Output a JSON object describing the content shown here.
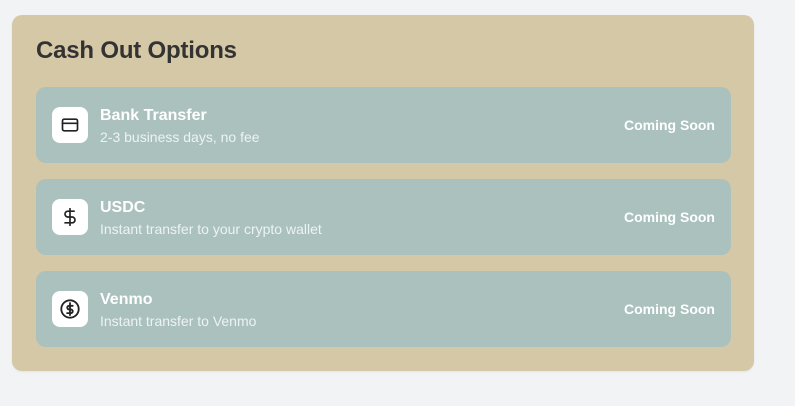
{
  "cash_out": {
    "title": "Cash Out Options",
    "options": [
      {
        "label": "Bank Transfer",
        "description": "2-3 business days, no fee",
        "status": "Coming Soon",
        "icon": "credit-card-icon"
      },
      {
        "label": "USDC",
        "description": "Instant transfer to your crypto wallet",
        "status": "Coming Soon",
        "icon": "dollar-sign-icon"
      },
      {
        "label": "Venmo",
        "description": "Instant transfer to Venmo",
        "status": "Coming Soon",
        "icon": "circle-dollar-icon"
      }
    ]
  },
  "colors": {
    "page_background": "#f2f3f5",
    "panel_background": "#d4c8a6",
    "option_background": "#aac1bd",
    "title_text": "#333333",
    "option_text": "#ffffff"
  }
}
